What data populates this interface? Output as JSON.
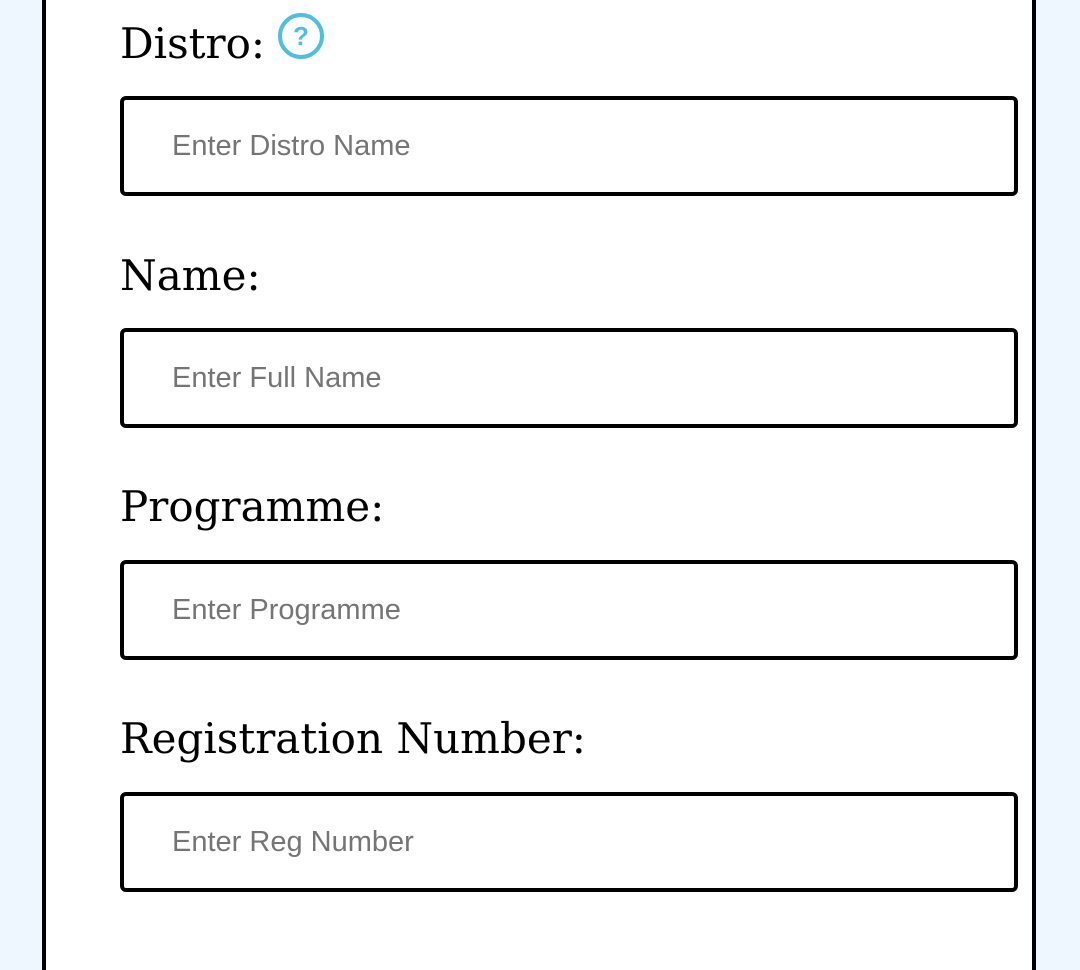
{
  "form": {
    "fields": [
      {
        "label": "Distro:",
        "placeholder": "Enter Distro Name",
        "value": ""
      },
      {
        "label": "Name:",
        "placeholder": "Enter Full Name",
        "value": ""
      },
      {
        "label": "Programme:",
        "placeholder": "Enter Programme",
        "value": ""
      },
      {
        "label": "Registration Number:",
        "placeholder": "Enter Reg Number",
        "value": ""
      }
    ],
    "help_icon": {
      "name": "help-question-icon",
      "glyph": "?",
      "color": "#4cc0e0"
    }
  }
}
